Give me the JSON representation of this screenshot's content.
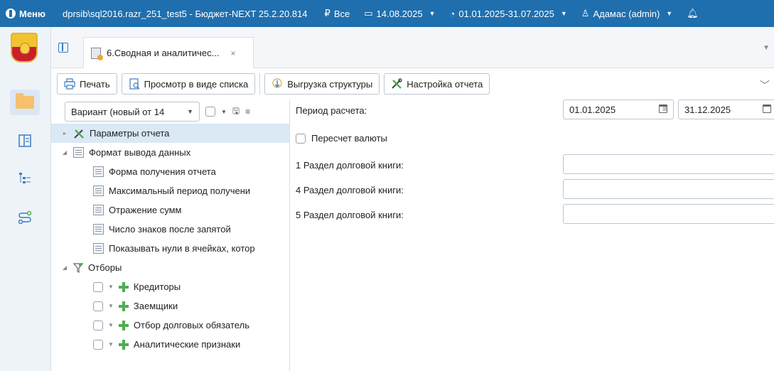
{
  "topbar": {
    "menu_label": "Меню",
    "title": "dprsib\\sql2016.razr_251_test5 - Бюджет-NEXT 25.2.20.814",
    "filter_label": "Все",
    "date_label": "14.08.2025",
    "period_label": "01.01.2025-31.07.2025",
    "user_label": "Адамас (admin)"
  },
  "tab": {
    "title": "6.Сводная и аналитичес...",
    "close": "×"
  },
  "toolbar": {
    "print_label": "Печать",
    "list_view_label": "Просмотр в виде списка",
    "export_structure_label": "Выгрузка структуры",
    "report_settings_label": "Настройка отчета"
  },
  "left": {
    "variant_value": "Вариант (новый от 14",
    "tree": [
      {
        "label": "Параметры отчета",
        "level": 0,
        "selected": true
      },
      {
        "label": "Формат вывода данных",
        "level": 0
      },
      {
        "label": "Форма получения отчета",
        "level": 1
      },
      {
        "label": "Максимальный период получени",
        "level": 1
      },
      {
        "label": "Отражение сумм",
        "level": 1
      },
      {
        "label": "Число знаков после запятой",
        "level": 1
      },
      {
        "label": "Показывать нули в ячейках, котор",
        "level": 1
      },
      {
        "label": "Отборы",
        "level": 0
      },
      {
        "label": "Кредиторы",
        "level": 1
      },
      {
        "label": "Заемщики",
        "level": 1
      },
      {
        "label": "Отбор долговых обязатель",
        "level": 1
      },
      {
        "label": "Аналитические признаки",
        "level": 1
      }
    ]
  },
  "right": {
    "period_label": "Период расчета:",
    "period_from": "01.01.2025",
    "period_to": "31.12.2025",
    "recalc_label": "Пересчет валюты",
    "section1_label": "1 Раздел долговой книги:",
    "section4_label": "4 Раздел долговой книги:",
    "section5_label": "5 Раздел долговой книги:"
  },
  "colors": {
    "topbar": "#1f6fae",
    "accent_green": "#4caf50",
    "selection": "#dbe8f5"
  },
  "icons": [
    "menu-icon",
    "filter-icon",
    "calendar-icon",
    "clock-icon",
    "user-icon",
    "print-icon",
    "list-icon",
    "export-icon",
    "settings-tools-icon",
    "folder-icon",
    "tree-icon",
    "route-icon",
    "plus-icon",
    "document-icon"
  ]
}
